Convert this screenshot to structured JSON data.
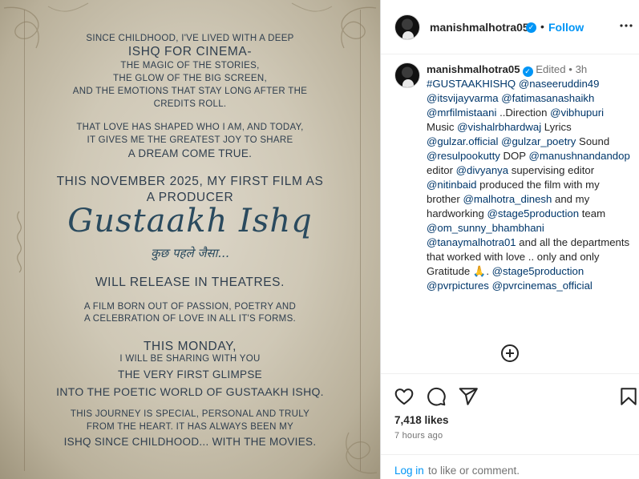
{
  "poster": {
    "lines": [
      "Since childhood, I've lived with a deep",
      "ISHQ  for cinema-",
      "the magic of the stories,",
      "the glow of the big screen,",
      "and the emotions that stay long after the",
      "credits roll.",
      "That love has shaped who I am, and today,",
      "it gives me the greatest joy to share",
      "a dream come true.",
      "This November 2025, my first film as",
      "a producer",
      "will release in theatres.",
      "A film born out of passion, poetry and",
      "a celebration of love in all it's forms.",
      "This Monday,",
      "I will be sharing with you",
      "the very FIRST GLIMPSE",
      "into the poetic world of GUSTAAKH ISHQ.",
      "This journey is special, personal and truly",
      "from the heart. It has always been my",
      "ISHQ SINCE CHILDHOOD... with the movies."
    ],
    "brand_title": "Gustaakh Ishq",
    "brand_subtitle": "कुछ पहले जैसा..."
  },
  "header": {
    "username": "manishmalhotra05",
    "dot": "•",
    "follow_label": "Follow",
    "more_icon": "more-options-icon"
  },
  "caption": {
    "username": "manishmalhotra05",
    "edited": "Edited",
    "dot": "•",
    "time": "3h",
    "segments": [
      {
        "t": "tag",
        "v": "#GUSTAAKHISHQ"
      },
      {
        "t": "txt",
        "v": " "
      },
      {
        "t": "tag",
        "v": "@naseeruddin49"
      },
      {
        "t": "txt",
        "v": " "
      },
      {
        "t": "tag",
        "v": "@itsvijayvarma"
      },
      {
        "t": "txt",
        "v": " "
      },
      {
        "t": "tag",
        "v": "@fatimasanashaikh"
      },
      {
        "t": "txt",
        "v": " "
      },
      {
        "t": "tag",
        "v": "@mrfilmistaani"
      },
      {
        "t": "txt",
        "v": " ..Direction "
      },
      {
        "t": "tag",
        "v": "@vibhupuri"
      },
      {
        "t": "txt",
        "v": " Music "
      },
      {
        "t": "tag",
        "v": "@vishalrbhardwaj"
      },
      {
        "t": "txt",
        "v": " Lyrics "
      },
      {
        "t": "tag",
        "v": "@gulzar.official"
      },
      {
        "t": "txt",
        "v": " "
      },
      {
        "t": "tag",
        "v": "@gulzar_poetry"
      },
      {
        "t": "txt",
        "v": " Sound "
      },
      {
        "t": "tag",
        "v": "@resulpookutty"
      },
      {
        "t": "txt",
        "v": " DOP "
      },
      {
        "t": "tag",
        "v": "@manushnandandop"
      },
      {
        "t": "txt",
        "v": " editor "
      },
      {
        "t": "tag",
        "v": "@divyanya"
      },
      {
        "t": "txt",
        "v": " supervising editor "
      },
      {
        "t": "tag",
        "v": "@nitinbaid"
      },
      {
        "t": "txt",
        "v": " produced the film with my brother "
      },
      {
        "t": "tag",
        "v": "@malhotra_dinesh"
      },
      {
        "t": "txt",
        "v": " and my hardworking "
      },
      {
        "t": "tag",
        "v": "@stage5production"
      },
      {
        "t": "txt",
        "v": " team "
      },
      {
        "t": "tag",
        "v": "@om_sunny_bhambhani"
      },
      {
        "t": "txt",
        "v": " "
      },
      {
        "t": "tag",
        "v": "@tanaymalhotra01"
      },
      {
        "t": "txt",
        "v": " and all the departments that worked with love .. only and only Gratitude 🙏. "
      },
      {
        "t": "tag",
        "v": "@stage5production"
      },
      {
        "t": "txt",
        "v": " "
      },
      {
        "t": "tag",
        "v": "@pvrpictures"
      },
      {
        "t": "txt",
        "v": " "
      },
      {
        "t": "tag",
        "v": "@pvrcinemas_official"
      }
    ],
    "load_more_icon": "plus-circle-icon"
  },
  "actions": {
    "icons": [
      "heart-icon",
      "comment-icon",
      "share-icon",
      "bookmark-icon"
    ],
    "likes": "7,418 likes",
    "ago": "7 hours ago",
    "login_label": "Log in",
    "login_rest": "to like or comment."
  },
  "colors": {
    "accent": "#0095f6",
    "link": "#00376b",
    "poster_ink": "#2f3e4e",
    "brand_ink": "#2a4a5e"
  }
}
